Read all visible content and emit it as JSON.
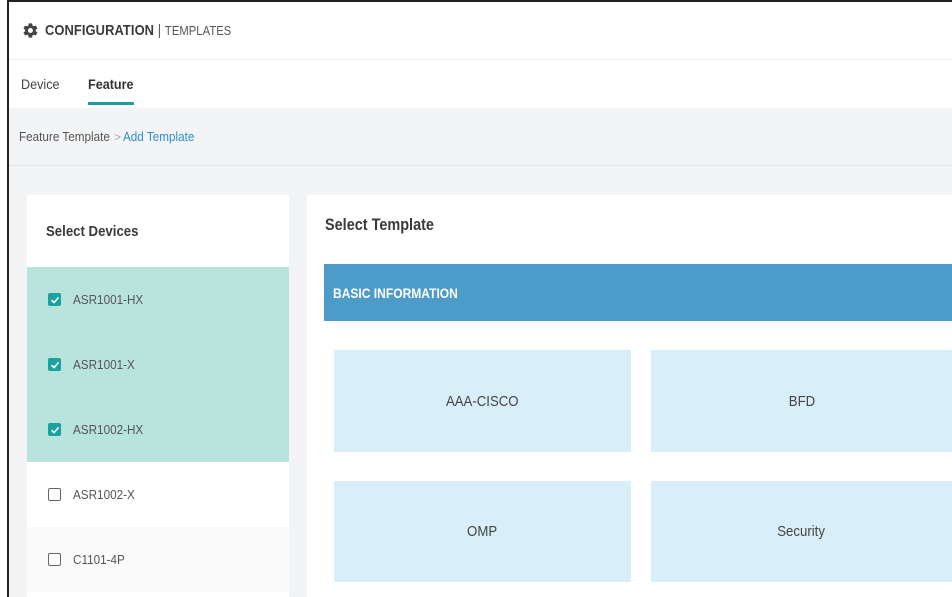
{
  "header": {
    "title": "CONFIGURATION",
    "separator": "|",
    "subtitle": "TEMPLATES",
    "icon": "gear-icon"
  },
  "tabs": [
    {
      "label": "Device",
      "active": false
    },
    {
      "label": "Feature",
      "active": true
    }
  ],
  "breadcrumb": {
    "items": [
      "Feature Template",
      "Add Template"
    ],
    "separator": ">"
  },
  "devices": {
    "title": "Select Devices",
    "items": [
      {
        "label": "ASR1001-HX",
        "checked": true
      },
      {
        "label": "ASR1001-X",
        "checked": true
      },
      {
        "label": "ASR1002-HX",
        "checked": true
      },
      {
        "label": "ASR1002-X",
        "checked": false
      },
      {
        "label": "C1101-4P",
        "checked": false
      }
    ]
  },
  "templates": {
    "title": "Select Template",
    "section": "BASIC INFORMATION",
    "tiles": [
      "AAA-CISCO",
      "BFD",
      "OMP",
      "Security"
    ]
  },
  "colors": {
    "accent": "#1d9ea0",
    "section_bar": "#4d9bc9",
    "tile_bg": "#d8eef8",
    "selected_row": "#b9e3dd",
    "link": "#2a8fd0"
  }
}
